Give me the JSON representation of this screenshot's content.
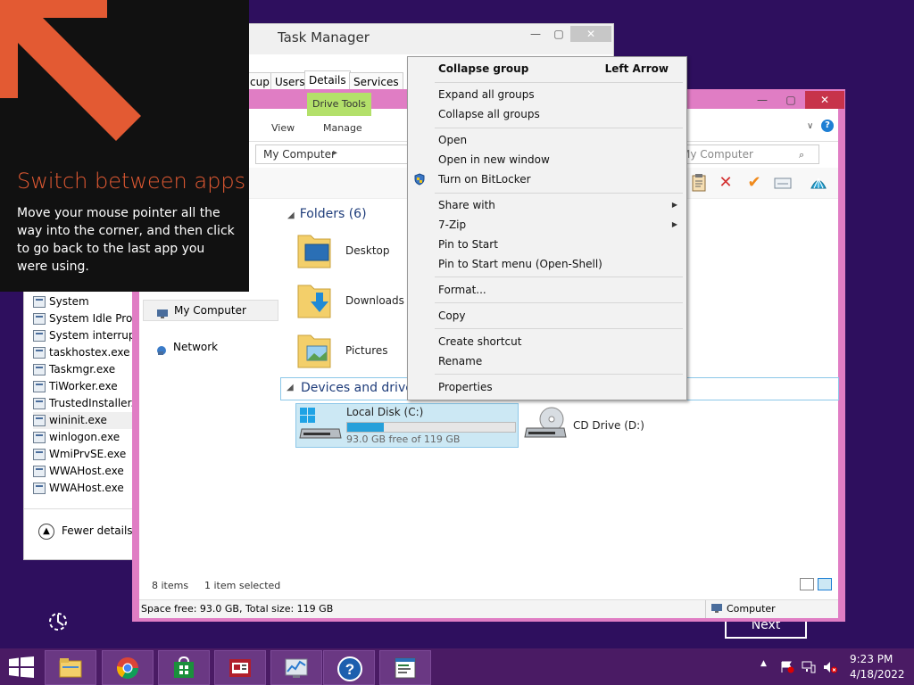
{
  "task_manager": {
    "title": "Task Manager",
    "tabs": [
      "cup",
      "Users",
      "Details",
      "Services"
    ],
    "active_tab": "Details",
    "processes": [
      "System",
      "System Idle Proce",
      "System interrupts",
      "taskhostex.exe",
      "Taskmgr.exe",
      "TiWorker.exe",
      "TrustedInstaller.e",
      "wininit.exe",
      "winlogon.exe",
      "WmiPrvSE.exe",
      "WWAHost.exe",
      "WWAHost.exe"
    ],
    "selected_process": "wininit.exe",
    "fewer_details": "Fewer details"
  },
  "tip": {
    "title": "Switch between apps",
    "body": "Move your mouse pointer all the way into the corner, and then click to go back to the last app you were using.",
    "accent_color": "#e35a33"
  },
  "explorer": {
    "ribbon_context_tab": "Drive Tools",
    "ribbon_tabs": [
      "View",
      "Manage"
    ],
    "address": "My Computer",
    "search_placeholder": "My Computer",
    "nav": [
      "My Computer",
      "Network"
    ],
    "folders_header": "Folders (6)",
    "folders": [
      "Desktop",
      "Downloads",
      "Pictures"
    ],
    "devices_header": "Devices and drives",
    "drives": {
      "c_label": "Local Disk (C:)",
      "c_free": "93.0 GB free of 119 GB",
      "c_used_fraction": 0.22,
      "d_label": "CD Drive (D:)"
    },
    "status_items": "8 items",
    "status_selected": "1 item selected",
    "details_left": "Space free: 93.0 GB, Total size: 119 GB",
    "details_right": "Computer"
  },
  "context_menu": {
    "header": "Collapse group",
    "header_shortcut": "Left Arrow",
    "groups": [
      [
        "Expand all groups",
        "Collapse all groups"
      ],
      [
        "Open",
        "Open in new window",
        "Turn on BitLocker"
      ],
      [
        "Share with",
        "7-Zip",
        "Pin to Start",
        "Pin to Start menu (Open-Shell)"
      ],
      [
        "Format..."
      ],
      [
        "Copy"
      ],
      [
        "Create shortcut",
        "Rename"
      ],
      [
        "Properties"
      ]
    ]
  },
  "tutorial": {
    "next_label": "Next"
  },
  "taskbar": {
    "time": "9:23 PM",
    "date": "4/18/2022",
    "apps": [
      "file-explorer",
      "chrome",
      "store",
      "news",
      "performance-monitor",
      "help",
      "notepad"
    ]
  }
}
